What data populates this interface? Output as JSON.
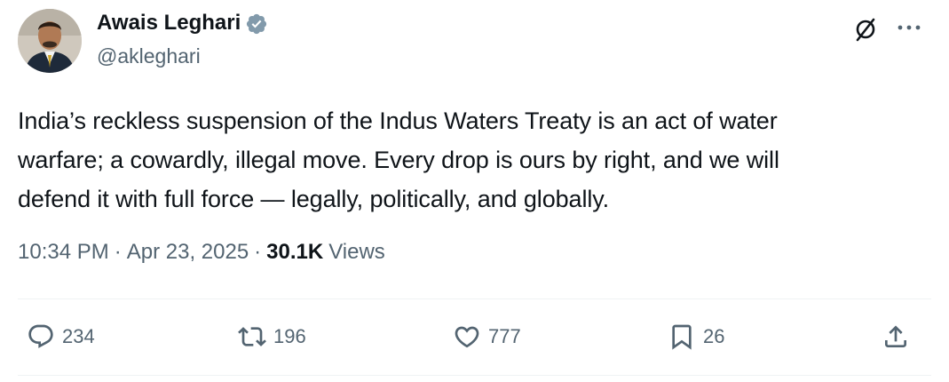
{
  "author": {
    "display_name": "Awais Leghari",
    "handle": "@akleghari",
    "verified": true,
    "avatar_icon": "profile-photo"
  },
  "header_icons": [
    "grok-icon",
    "more-icon"
  ],
  "tweet": {
    "text_lines": [
      "India’s reckless suspension of the Indus Waters Treaty is an act of water",
      "warfare; a cowardly, illegal move. Every drop is ours by right, and we will",
      "defend it with full force — legally, politically, and globally."
    ]
  },
  "meta": {
    "time": "10:34 PM",
    "separator": "·",
    "date": "Apr 23, 2025",
    "views_count": "30.1K",
    "views_label": "Views"
  },
  "actions": {
    "replies": "234",
    "retweets": "196",
    "likes": "777",
    "bookmarks": "26"
  },
  "colors": {
    "text": "#0f1419",
    "secondary": "#536471",
    "verified": "#829aab",
    "divider": "#eff3f4"
  }
}
